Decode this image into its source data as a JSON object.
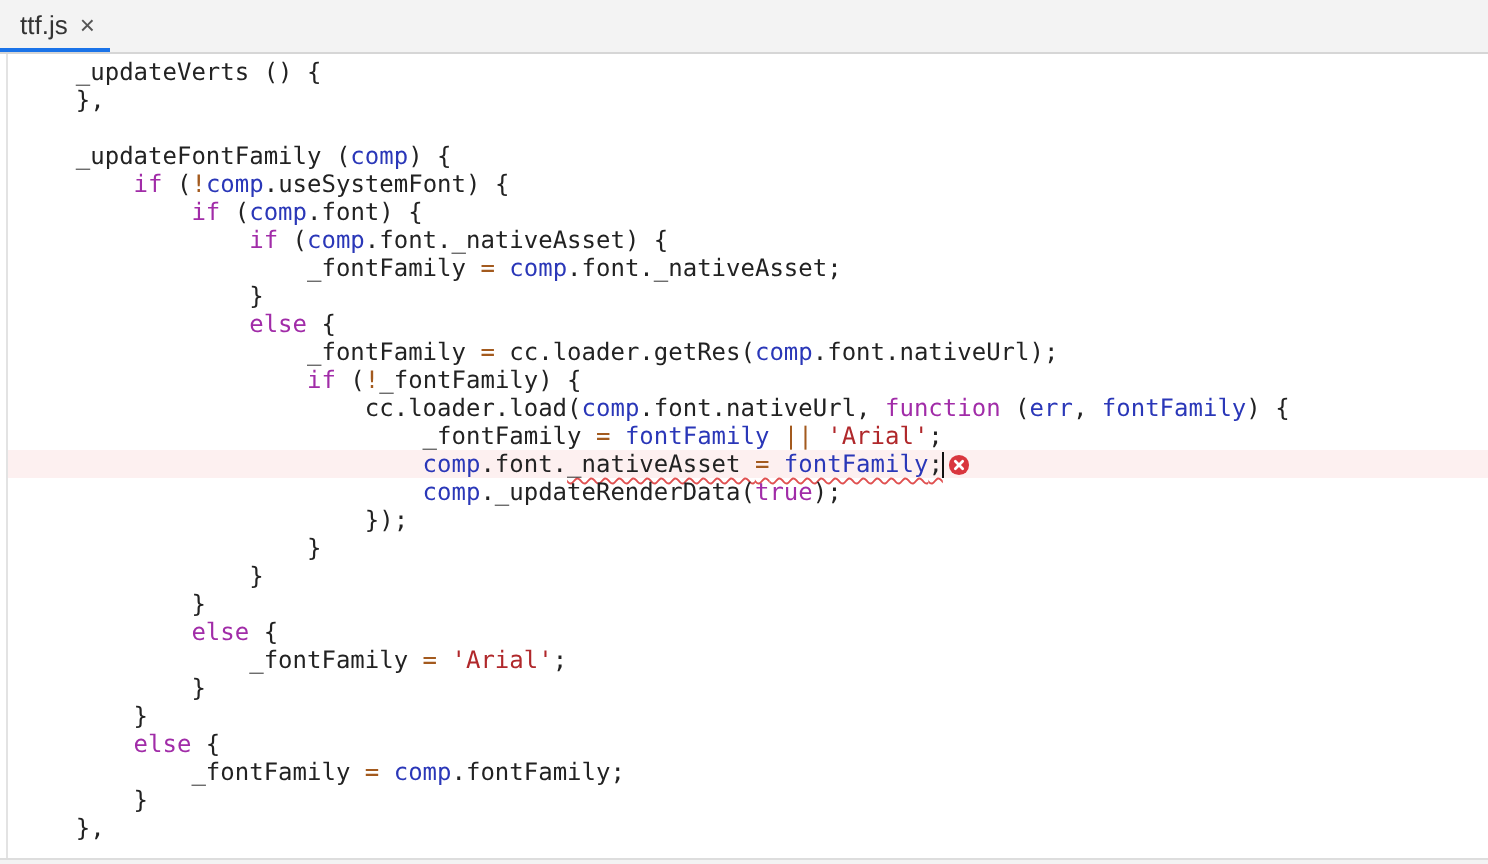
{
  "tabs": [
    {
      "label": "ttf.js",
      "close": "×",
      "selected": true
    }
  ],
  "editor": {
    "lines": [
      {
        "error": false,
        "cursor": false,
        "tokens": [
          {
            "kind": "text",
            "text": "    _updateVerts () {"
          }
        ]
      },
      {
        "error": false,
        "cursor": false,
        "tokens": [
          {
            "kind": "text",
            "text": "    },"
          }
        ]
      },
      {
        "error": false,
        "cursor": false
      },
      {
        "error": false,
        "cursor": false,
        "tokens": [
          {
            "kind": "text",
            "text": "    _updateFontFamily ("
          },
          {
            "kind": "param",
            "text": "comp"
          },
          {
            "kind": "text",
            "text": ") {"
          }
        ]
      },
      {
        "error": false,
        "cursor": false,
        "tokens": [
          {
            "kind": "keyword",
            "text": "        if"
          },
          {
            "kind": "text",
            "text": " ("
          },
          {
            "kind": "operator",
            "text": "!"
          },
          {
            "kind": "param",
            "text": "comp"
          },
          {
            "kind": "text",
            "text": ".useSystemFont) {"
          }
        ]
      },
      {
        "error": false,
        "cursor": false,
        "tokens": [
          {
            "kind": "keyword",
            "text": "            if"
          },
          {
            "kind": "text",
            "text": " ("
          },
          {
            "kind": "param",
            "text": "comp"
          },
          {
            "kind": "text",
            "text": ".font) {"
          }
        ]
      },
      {
        "error": false,
        "cursor": false,
        "tokens": [
          {
            "kind": "keyword",
            "text": "                if"
          },
          {
            "kind": "text",
            "text": " ("
          },
          {
            "kind": "param",
            "text": "comp"
          },
          {
            "kind": "text",
            "text": ".font._nativeAsset) {"
          }
        ]
      },
      {
        "error": false,
        "cursor": false,
        "tokens": [
          {
            "kind": "text",
            "text": "                    _fontFamily "
          },
          {
            "kind": "operator",
            "text": "="
          },
          {
            "kind": "param",
            "text": " comp"
          },
          {
            "kind": "text",
            "text": ".font._nativeAsset;"
          }
        ]
      },
      {
        "error": false,
        "cursor": false,
        "tokens": [
          {
            "kind": "text",
            "text": "                }"
          }
        ]
      },
      {
        "error": false,
        "cursor": false,
        "tokens": [
          {
            "kind": "keyword",
            "text": "                else"
          },
          {
            "kind": "text",
            "text": " {"
          }
        ]
      },
      {
        "error": false,
        "cursor": false,
        "tokens": [
          {
            "kind": "text",
            "text": "                    _fontFamily "
          },
          {
            "kind": "operator",
            "text": "="
          },
          {
            "kind": "text",
            "text": " cc.loader.getRes("
          },
          {
            "kind": "param",
            "text": "comp"
          },
          {
            "kind": "text",
            "text": ".font.nativeUrl);"
          }
        ]
      },
      {
        "error": false,
        "cursor": false,
        "tokens": [
          {
            "kind": "keyword",
            "text": "                    if"
          },
          {
            "kind": "text",
            "text": " ("
          },
          {
            "kind": "operator",
            "text": "!"
          },
          {
            "kind": "text",
            "text": "_fontFamily) {"
          }
        ]
      },
      {
        "error": false,
        "cursor": false,
        "tokens": [
          {
            "kind": "text",
            "text": "                        cc.loader.load("
          },
          {
            "kind": "param",
            "text": "comp"
          },
          {
            "kind": "text",
            "text": ".font.nativeUrl, "
          },
          {
            "kind": "keyword",
            "text": "function"
          },
          {
            "kind": "text",
            "text": " ("
          },
          {
            "kind": "param",
            "text": "err"
          },
          {
            "kind": "text",
            "text": ", "
          },
          {
            "kind": "param",
            "text": "fontFamily"
          },
          {
            "kind": "text",
            "text": ") {"
          }
        ]
      },
      {
        "error": false,
        "cursor": false,
        "tokens": [
          {
            "kind": "text",
            "text": "                            _fontFamily "
          },
          {
            "kind": "operator",
            "text": "="
          },
          {
            "kind": "param",
            "text": " fontFamily "
          },
          {
            "kind": "operator",
            "text": "||"
          },
          {
            "kind": "string",
            "text": " 'Arial'"
          },
          {
            "kind": "text",
            "text": ";"
          }
        ]
      },
      {
        "error": true,
        "cursor": true,
        "tokens": [
          {
            "kind": "param",
            "text": "                            comp",
            "squiggle": false
          },
          {
            "kind": "text",
            "text": ".font.",
            "squiggle": false
          },
          {
            "kind": "text",
            "text": "_nativeAsset ",
            "squiggle": true
          },
          {
            "kind": "operator",
            "text": "=",
            "squiggle": true
          },
          {
            "kind": "param",
            "text": " fontFamily",
            "squiggle": true
          },
          {
            "kind": "text",
            "text": ";",
            "squiggle": true
          }
        ]
      },
      {
        "error": false,
        "cursor": false,
        "tokens": [
          {
            "kind": "param",
            "text": "                            comp"
          },
          {
            "kind": "text",
            "text": "._updateRenderData("
          },
          {
            "kind": "keyword",
            "text": "true"
          },
          {
            "kind": "text",
            "text": ");"
          }
        ]
      },
      {
        "error": false,
        "cursor": false,
        "tokens": [
          {
            "kind": "text",
            "text": "                        });"
          }
        ]
      },
      {
        "error": false,
        "cursor": false,
        "tokens": [
          {
            "kind": "text",
            "text": "                    }"
          }
        ]
      },
      {
        "error": false,
        "cursor": false,
        "tokens": [
          {
            "kind": "text",
            "text": "                }"
          }
        ]
      },
      {
        "error": false,
        "cursor": false,
        "tokens": [
          {
            "kind": "text",
            "text": "            }"
          }
        ]
      },
      {
        "error": false,
        "cursor": false,
        "tokens": [
          {
            "kind": "keyword",
            "text": "            else"
          },
          {
            "kind": "text",
            "text": " {"
          }
        ]
      },
      {
        "error": false,
        "cursor": false,
        "tokens": [
          {
            "kind": "text",
            "text": "                _fontFamily "
          },
          {
            "kind": "operator",
            "text": "="
          },
          {
            "kind": "string",
            "text": " 'Arial'"
          },
          {
            "kind": "text",
            "text": ";"
          }
        ]
      },
      {
        "error": false,
        "cursor": false,
        "tokens": [
          {
            "kind": "text",
            "text": "            }"
          }
        ]
      },
      {
        "error": false,
        "cursor": false,
        "tokens": [
          {
            "kind": "text",
            "text": "        }"
          }
        ]
      },
      {
        "error": false,
        "cursor": false,
        "tokens": [
          {
            "kind": "keyword",
            "text": "        else"
          },
          {
            "kind": "text",
            "text": " {"
          }
        ]
      },
      {
        "error": false,
        "cursor": false,
        "tokens": [
          {
            "kind": "text",
            "text": "            _fontFamily "
          },
          {
            "kind": "operator",
            "text": "="
          },
          {
            "kind": "param",
            "text": " comp"
          },
          {
            "kind": "text",
            "text": ".fontFamily;"
          }
        ]
      },
      {
        "error": false,
        "cursor": false,
        "tokens": [
          {
            "kind": "text",
            "text": "        }"
          }
        ]
      },
      {
        "error": false,
        "cursor": false,
        "tokens": [
          {
            "kind": "text",
            "text": "    },"
          }
        ]
      }
    ]
  }
}
